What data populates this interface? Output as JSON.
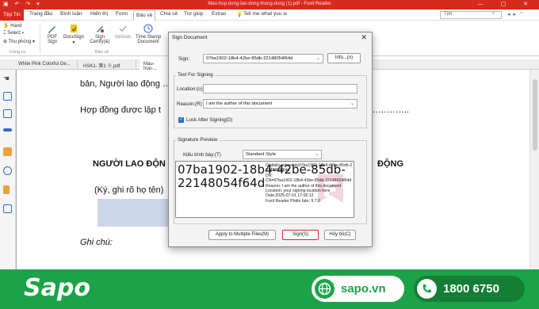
{
  "window": {
    "title": "Mau-hop-dong-lao-dong-thong-dung (1).pdf - Foxit Reader",
    "quick_access": "▣ ↶ ↷ ▾",
    "controls": "— ▢ ✕"
  },
  "ribbon_tabs": [
    "Tệp Tin",
    "Trang đầu",
    "Bình luận",
    "Hiển thị",
    "Form",
    "Bảo vệ",
    "Chia sẻ",
    "Trợ giúp",
    "Extras"
  ],
  "tell_me": "Tell me what you w",
  "search": {
    "value": "Tìm"
  },
  "ribbon": {
    "hand": "Hand",
    "select": "Select",
    "zoom": "Thu phóng",
    "tools_group": "Công cụ",
    "pdf_sign": "PDF\nSign",
    "docusign": "DocuSign",
    "sign_certify": "Sign\nCertify(&)",
    "validate": "Validate",
    "timestamp": "Time Stamp\nDocument",
    "protect_group": "Bảo vệ"
  },
  "doc_tabs": [
    "White Pink Colorful Ge...",
    "HSK1- 第1 ※.pdf",
    "Mau-hop-..."
  ],
  "document": {
    "line1": "bản, Người lao động … … năm 20...",
    "line2_left": "Hợp đồng được lập t",
    "line2_right": "…………..",
    "heading_left": "NGƯỜI LAO ĐỘN",
    "heading_right": "ĐỘNG",
    "sign_note": "(Ký, ghi rõ họ tên)",
    "ghi_chu": "Ghi chú:"
  },
  "dialog": {
    "title": "Sign Document",
    "sign_label": "Sign:",
    "sign_value": "07ba1902-18b4-42be-85db-22148054f64d",
    "info_button": "Info...(n)",
    "text_for_signing": "Text For Signing",
    "location_label": "Location:(o)",
    "location_value": "",
    "reason_label": "Reason:(R)",
    "reason_value": "I am the author of this document",
    "lock_label": "Lock After Signing(D)",
    "lock_checked": true,
    "signature_preview": "Signature Preview",
    "style_label": "Kiểu trình bày:(T)",
    "style_value": "Standard Style",
    "preview_name": "07ba1902-18b4-42be-85db-22148054f64d",
    "preview_details": "Digitally signed by07ba1902-18b4-42be-85db-22148054f64d\nDN:\nCN=07ba1902-18b4-42be-85db-22148054f64d\nReason: I am the author of this document\nLocation: your signing location here\nDate:2025-07-01 17:05:12\nFoxit Reader Phiên bản: 9.7.0",
    "apply_button": "Apply to Multiple Files(M)",
    "sign_button": "Sign(S)",
    "cancel_button": "Hủy bỏ(C)"
  },
  "banner": {
    "brand": "Sapo",
    "website": "sapo.vn",
    "phone": "1800 6750"
  },
  "colors": {
    "accent": "#d72a1f",
    "sapo_green": "#1ca347",
    "sapo_dark": "#147e36"
  }
}
